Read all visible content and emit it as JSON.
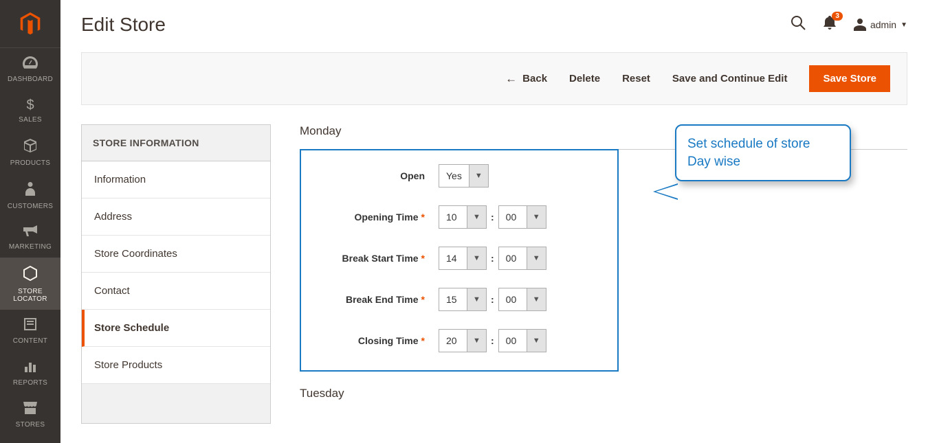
{
  "sidebar": {
    "items": [
      {
        "label": "DASHBOARD",
        "icon": "dashboard"
      },
      {
        "label": "SALES",
        "icon": "sales"
      },
      {
        "label": "PRODUCTS",
        "icon": "products"
      },
      {
        "label": "CUSTOMERS",
        "icon": "customers"
      },
      {
        "label": "MARKETING",
        "icon": "marketing"
      },
      {
        "label": "STORE LOCATOR",
        "icon": "storelocator"
      },
      {
        "label": "CONTENT",
        "icon": "content"
      },
      {
        "label": "REPORTS",
        "icon": "reports"
      },
      {
        "label": "STORES",
        "icon": "stores"
      }
    ]
  },
  "header": {
    "title": "Edit Store",
    "badge_count": "3",
    "admin_label": "admin"
  },
  "actions": {
    "back": "Back",
    "delete": "Delete",
    "reset": "Reset",
    "save_continue": "Save and Continue Edit",
    "save": "Save Store"
  },
  "tabs": {
    "title": "STORE INFORMATION",
    "items": [
      {
        "label": "Information"
      },
      {
        "label": "Address"
      },
      {
        "label": "Store Coordinates"
      },
      {
        "label": "Contact"
      },
      {
        "label": "Store Schedule"
      },
      {
        "label": "Store Products"
      }
    ],
    "active_index": 4
  },
  "schedule": {
    "day1": "Monday",
    "day2": "Tuesday",
    "labels": {
      "open": "Open",
      "opening_time": "Opening Time",
      "break_start": "Break Start Time",
      "break_end": "Break End Time",
      "closing_time": "Closing Time"
    },
    "values": {
      "open": "Yes",
      "opening_h": "10",
      "opening_m": "00",
      "break_start_h": "14",
      "break_start_m": "00",
      "break_end_h": "15",
      "break_end_m": "00",
      "closing_h": "20",
      "closing_m": "00"
    }
  },
  "callout": {
    "line1": "Set schedule of store",
    "line2": "Day wise"
  }
}
